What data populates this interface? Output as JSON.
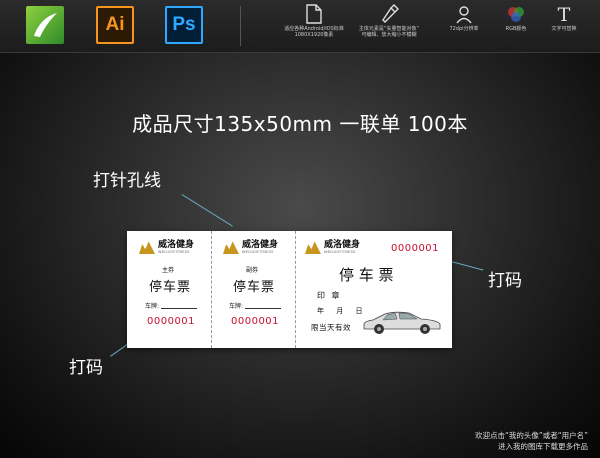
{
  "toolbar": {
    "apps": [
      {
        "name": "CorelDRAW",
        "label": ""
      },
      {
        "name": "Illustrator",
        "label": "Ai"
      },
      {
        "name": "Photoshop",
        "label": "Ps"
      }
    ],
    "features": [
      {
        "icon": "document-icon",
        "label": "适应各种Android/IOS标准\n1080X1920像素"
      },
      {
        "icon": "pen-icon",
        "label": "主体元素是“矢量智能对象”\n可编辑、放大缩小不模糊"
      },
      {
        "icon": "resolution-icon",
        "label": "72dpi分辨率"
      },
      {
        "icon": "rgb-icon",
        "label": "RGB颜色"
      },
      {
        "icon": "text-icon",
        "label": "文字可替换"
      }
    ]
  },
  "headline": "成品尺寸135x50mm 一联单 100本",
  "notes": {
    "perforation": "打针孔线",
    "number_right": "打码",
    "number_left": "打码"
  },
  "ticket": {
    "brand_cn": "威洛健身",
    "brand_en": "WEILUOFITNESS",
    "stub1": {
      "type": "主券",
      "title": "停车票",
      "plate_label": "车牌:",
      "serial": "0000001"
    },
    "stub2": {
      "type": "副券",
      "title": "停车票",
      "plate_label": "车牌:",
      "serial": "0000001"
    },
    "main": {
      "serial": "0000001",
      "title": "停 车 票",
      "seal": "印 章",
      "date": "年 月 日",
      "validity": "限当天有效"
    }
  },
  "footer": {
    "line1": "欢迎点击“我的头像”或者“用户名”",
    "line2": "进入我的图库下载更多作品"
  },
  "colors": {
    "serial_red": "#c8102e",
    "brand_gold": "#c8961e"
  }
}
